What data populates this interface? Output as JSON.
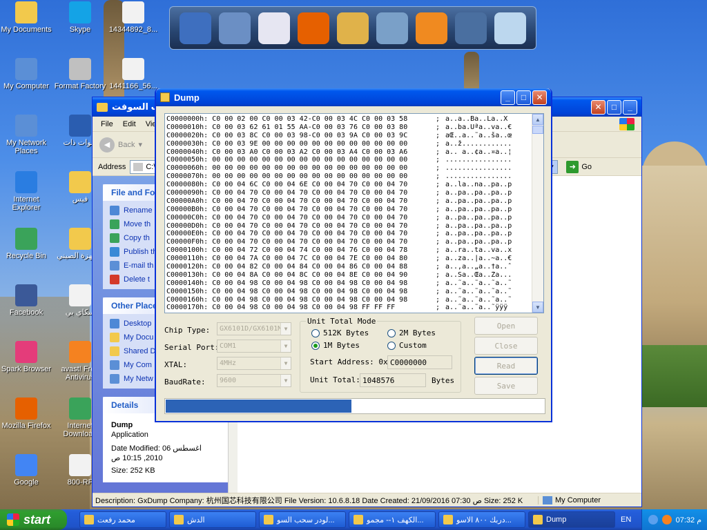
{
  "desktop_icons": [
    {
      "label": "My Documents",
      "icon": "folder-icon",
      "color": "#f2c94c"
    },
    {
      "label": "Skype",
      "icon": "skype-icon",
      "color": "#14a3e6"
    },
    {
      "label": "14344892_8...",
      "icon": "image-file-icon",
      "color": "#f2f2f2"
    },
    {
      "label": "My Computer",
      "icon": "computer-icon",
      "color": "#5b8fd6"
    },
    {
      "label": "Format Factory",
      "icon": "format-factory-icon",
      "color": "#c0c0c0"
    },
    {
      "label": "1441166_56...",
      "icon": "image-file-icon",
      "color": "#f2f2f2"
    },
    {
      "label": "My Network Places",
      "icon": "network-icon",
      "color": "#5b8fd6"
    },
    {
      "label": "قنوات ذات",
      "icon": "word-doc-icon",
      "color": "#2a5db0"
    },
    {
      "label": "Internet Explorer",
      "icon": "ie-icon",
      "color": "#2a7de1"
    },
    {
      "label": "فيس",
      "icon": "folder-icon",
      "color": "#f2c94c"
    },
    {
      "label": "Recycle Bin",
      "icon": "recycle-bin-icon",
      "color": "#3aa35a"
    },
    {
      "label": "الأجهزة الصيني",
      "icon": "folder-icon",
      "color": "#f2c94c"
    },
    {
      "label": "Facebook",
      "icon": "facebook-icon",
      "color": "#3b5998"
    },
    {
      "label": "سكاي بي",
      "icon": "text-file-icon",
      "color": "#f2f2f2"
    },
    {
      "label": "Spark Browser",
      "icon": "spark-icon",
      "color": "#e43c7a"
    },
    {
      "label": "avast! Free Antivirus",
      "icon": "avast-icon",
      "color": "#f58220"
    },
    {
      "label": "Mozilla Firefox",
      "icon": "firefox-icon",
      "color": "#e66000"
    },
    {
      "label": "Internet Download",
      "icon": "idm-icon",
      "color": "#3aa35a"
    },
    {
      "label": "Google",
      "icon": "google-icon",
      "color": "#4285f4"
    },
    {
      "label": "800-RF",
      "icon": "image-file-icon",
      "color": "#f2f2f2"
    }
  ],
  "dock_icons": [
    "computer-icon",
    "display-settings-icon",
    "spark-browser-icon",
    "firefox-icon",
    "folder-icon",
    "pictures-icon",
    "media-player-icon",
    "settings-gears-icon",
    "recycle-bin-icon"
  ],
  "explorer": {
    "title": "سحب السوفت",
    "menu": [
      "File",
      "Edit",
      "View"
    ],
    "back_label": "Back",
    "address_label": "Address",
    "address_value": "C:\\",
    "go_label": "Go",
    "file_folder_tasks": "File and Fol",
    "tasks": [
      "Rename",
      "Move th",
      "Copy th",
      "Publish th Web",
      "E-mail th",
      "Delete t"
    ],
    "other_places": "Other Place",
    "places": [
      "Desktop",
      "My Docu",
      "Shared D",
      "My Com",
      "My Netw"
    ],
    "details_head": "Details",
    "details_name": "Dump",
    "details_type": "Application",
    "details_modified": "Date Modified: 06 اغسطس 2010, 10:15 ص",
    "details_size": "Size: 252 KB",
    "status": "Description: GxDump Company: 杭州国芯科技有限公司 File Version: 10.6.8.18 Date Created: 21/09/2016 07:30 ﺹ Size: 252 KB",
    "status_right": "My Computer"
  },
  "dump": {
    "title": "Dump",
    "hex_rows": [
      {
        "addr": "C0000000h:",
        "hex": "C0 00 02 00 C0 00 03 42-C0 00 03 4C C0 00 03 58",
        "ascii": "a..a..Ba..La..X"
      },
      {
        "addr": "C0000010h:",
        "hex": "C0 00 03 62 61 01 55 AA-C0 00 03 76 C0 00 03 80",
        "ascii": "a..ba.Uªa..va..€"
      },
      {
        "addr": "C0000020h:",
        "hex": "C0 00 03 8C C0 00 03 98-C0 00 03 9A C0 00 03 9C",
        "ascii": "aŒ..a..˜a..ša..œ"
      },
      {
        "addr": "C0000030h:",
        "hex": "C0 00 03 9E 00 00 00 00 00 00 00 00 00 00 00 00",
        "ascii": "a..ž............"
      },
      {
        "addr": "C0000040h:",
        "hex": "C0 00 03 A0 C0 00 03 A2 C0 00 03 A4 C0 00 03 A6",
        "ascii": "a.. a..¢a..¤a..¦"
      },
      {
        "addr": "C0000050h:",
        "hex": "00 00 00 00 00 00 00 00 00 00 00 00 00 00 00 00",
        "ascii": "................"
      },
      {
        "addr": "C0000060h:",
        "hex": "00 00 00 00 00 00 00 00 00 00 00 00 00 00 00 00",
        "ascii": "................"
      },
      {
        "addr": "C0000070h:",
        "hex": "00 00 00 00 00 00 00 00 00 00 00 00 00 00 00 00",
        "ascii": "................"
      },
      {
        "addr": "C0000080h:",
        "hex": "C0 00 04 6C C0 00 04 6E C0 00 04 70 C0 00 04 70",
        "ascii": "a..la..na..pa..p"
      },
      {
        "addr": "C0000090h:",
        "hex": "C0 00 04 70 C0 00 04 70 C0 00 04 70 C0 00 04 70",
        "ascii": "a..pa..pa..pa..p"
      },
      {
        "addr": "C00000A0h:",
        "hex": "C0 00 04 70 C0 00 04 70 C0 00 04 70 C0 00 04 70",
        "ascii": "a..pa..pa..pa..p"
      },
      {
        "addr": "C00000B0h:",
        "hex": "C0 00 04 70 C0 00 04 70 C0 00 04 70 C0 00 04 70",
        "ascii": "a..pa..pa..pa..p"
      },
      {
        "addr": "C00000C0h:",
        "hex": "C0 00 04 70 C0 00 04 70 C0 00 04 70 C0 00 04 70",
        "ascii": "a..pa..pa..pa..p"
      },
      {
        "addr": "C00000D0h:",
        "hex": "C0 00 04 70 C0 00 04 70 C0 00 04 70 C0 00 04 70",
        "ascii": "a..pa..pa..pa..p"
      },
      {
        "addr": "C00000E0h:",
        "hex": "C0 00 04 70 C0 00 04 70 C0 00 04 70 C0 00 04 70",
        "ascii": "a..pa..pa..pa..p"
      },
      {
        "addr": "C00000F0h:",
        "hex": "C0 00 04 70 C0 00 04 70 C0 00 04 70 C0 00 04 70",
        "ascii": "a..pa..pa..pa..p"
      },
      {
        "addr": "C0000100h:",
        "hex": "C0 00 04 72 C0 00 04 74 C0 00 04 76 C0 00 04 78",
        "ascii": "a..ra..ta..va..x"
      },
      {
        "addr": "C0000110h:",
        "hex": "C0 00 04 7A C0 00 04 7C C0 00 04 7E C0 00 04 80",
        "ascii": "a..za..|a..~a..€"
      },
      {
        "addr": "C0000120h:",
        "hex": "C0 00 04 82 C0 00 04 84 C0 00 04 86 C0 00 04 88",
        "ascii": "a..‚a..„a..†a..ˆ"
      },
      {
        "addr": "C0000130h:",
        "hex": "C0 00 04 8A C0 00 04 8C C0 00 04 8E C0 00 04 90",
        "ascii": "a..Ša..Œa..Ža..."
      },
      {
        "addr": "C0000140h:",
        "hex": "C0 00 04 98 C0 00 04 98 C0 00 04 98 C0 00 04 98",
        "ascii": "a..˜a..˜a..˜a..˜"
      },
      {
        "addr": "C0000150h:",
        "hex": "C0 00 04 98 C0 00 04 98 C0 00 04 98 C0 00 04 98",
        "ascii": "a..˜a..˜a..˜a..˜"
      },
      {
        "addr": "C0000160h:",
        "hex": "C0 00 04 98 C0 00 04 98 C0 00 04 98 C0 00 04 98",
        "ascii": "a..˜a..˜a..˜a..˜"
      },
      {
        "addr": "C0000170h:",
        "hex": "C0 00 04 98 C0 00 04 98 C0 00 04 98 FF FF FF",
        "ascii": "a..˜a..˜a..˜ÿÿÿ"
      }
    ],
    "chip_type_label": "Chip Type:",
    "chip_type_value": "GX6101D/GX6101M",
    "serial_port_label": "Serial Port:",
    "serial_port_value": "COM1",
    "xtal_label": "XTAL:",
    "xtal_value": "4MHz",
    "baudrate_label": "BaudRate:",
    "baudrate_value": "9600",
    "unit_mode_legend": "Unit Total Mode",
    "radio_512k": "512K Bytes",
    "radio_2m": "2M Bytes",
    "radio_1m": "1M Bytes",
    "radio_custom": "Custom",
    "start_address_label": "Start Address: 0x",
    "start_address_value": "C0000000",
    "unit_total_label": "Unit Total:",
    "unit_total_value": "1048576",
    "bytes_label": "Bytes",
    "btn_open": "Open",
    "btn_close": "Close",
    "btn_read": "Read",
    "btn_save": "Save",
    "progress": 0.49
  },
  "taskbar": {
    "start_label": "start",
    "items": [
      "محمد رفعت",
      "الدش",
      "لودر سحب السو...",
      "الكهف ١-- مجمو...",
      "دربك ٨٠٠ الاسو...",
      "Dump"
    ],
    "lang": "EN",
    "clock": "07:32 م"
  }
}
